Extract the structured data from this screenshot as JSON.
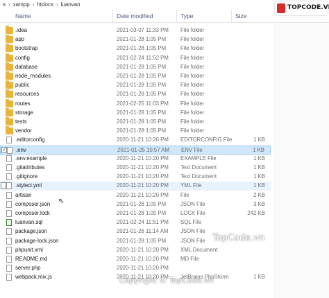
{
  "breadcrumb": [
    "s",
    "xampp",
    "htdocs",
    "luanvan"
  ],
  "columns": {
    "name": "Name",
    "date": "Date modified",
    "type": "Type",
    "size": "Size"
  },
  "logo_text": "TOPCODE.VN",
  "watermark_top": "TopCode.vn",
  "watermark_bottom": "Copyright © TopCode.vn",
  "files": [
    {
      "name": ".idea",
      "date": "2021-03-07 11:33 PM",
      "type": "File folder",
      "size": "",
      "icon": "folder-icon"
    },
    {
      "name": "app",
      "date": "2021-01-28 1:05 PM",
      "type": "File folder",
      "size": "",
      "icon": "folder-icon"
    },
    {
      "name": "bootstrap",
      "date": "2021-01-28 1:05 PM",
      "type": "File folder",
      "size": "",
      "icon": "folder-icon"
    },
    {
      "name": "config",
      "date": "2021-02-24 11:52 PM",
      "type": "File folder",
      "size": "",
      "icon": "folder-icon"
    },
    {
      "name": "database",
      "date": "2021-01-28 1:05 PM",
      "type": "File folder",
      "size": "",
      "icon": "folder-icon"
    },
    {
      "name": "node_modules",
      "date": "2021-01-28 1:05 PM",
      "type": "File folder",
      "size": "",
      "icon": "folder-icon"
    },
    {
      "name": "public",
      "date": "2021-01-28 1:05 PM",
      "type": "File folder",
      "size": "",
      "icon": "folder-icon"
    },
    {
      "name": "resources",
      "date": "2021-01-28 1:05 PM",
      "type": "File folder",
      "size": "",
      "icon": "folder-icon"
    },
    {
      "name": "routes",
      "date": "2021-02-25 11:03 PM",
      "type": "File folder",
      "size": "",
      "icon": "folder-icon"
    },
    {
      "name": "storage",
      "date": "2021-01-28 1:05 PM",
      "type": "File folder",
      "size": "",
      "icon": "folder-icon"
    },
    {
      "name": "tests",
      "date": "2021-01-28 1:05 PM",
      "type": "File folder",
      "size": "",
      "icon": "folder-icon"
    },
    {
      "name": "vendor",
      "date": "2021-01-28 1:05 PM",
      "type": "File folder",
      "size": "",
      "icon": "folder-icon"
    },
    {
      "name": ".editorconfig",
      "date": "2020-11-21 10:20 PM",
      "type": "EDITORCONFIG File",
      "size": "1 KB",
      "icon": "file-icon"
    },
    {
      "name": ".env",
      "date": "2021-01-25 10:57 AM",
      "type": "ENV File",
      "size": "1 KB",
      "icon": "file-icon",
      "selected": true
    },
    {
      "name": ".env.example",
      "date": "2020-11-21 10:20 PM",
      "type": "EXAMPLE File",
      "size": "1 KB",
      "icon": "file-icon"
    },
    {
      "name": ".gitattributes",
      "date": "2020-11-21 10:20 PM",
      "type": "Text Document",
      "size": "1 KB",
      "icon": "file-icon"
    },
    {
      "name": ".gitignore",
      "date": "2020-11-21 10:20 PM",
      "type": "Text Document",
      "size": "1 KB",
      "icon": "file-icon"
    },
    {
      "name": ".styleci.yml",
      "date": "2020-11-21 10:20 PM",
      "type": "YML File",
      "size": "1 KB",
      "icon": "file-icon",
      "hover": true
    },
    {
      "name": "artisan",
      "date": "2020-11-21 10:20 PM",
      "type": "File",
      "size": "2 KB",
      "icon": "file-icon"
    },
    {
      "name": "composer.json",
      "date": "2021-01-28 1:05 PM",
      "type": "JSON File",
      "size": "3 KB",
      "icon": "file-icon"
    },
    {
      "name": "composer.lock",
      "date": "2021-01-28 1:05 PM",
      "type": "LOCK File",
      "size": "242 KB",
      "icon": "file-icon"
    },
    {
      "name": "luanvan.sql",
      "date": "2021-02-24 11:51 PM",
      "type": "SQL File",
      "size": "",
      "icon": "sql-file-icon"
    },
    {
      "name": "package.json",
      "date": "2021-01-26 11:14 AM",
      "type": "JSON File",
      "size": "",
      "icon": "file-icon"
    },
    {
      "name": "package-lock.json",
      "date": "2021-01-28 1:05 PM",
      "type": "JSON File",
      "size": "",
      "icon": "file-icon"
    },
    {
      "name": "phpunit.xml",
      "date": "2020-11-21 10:20 PM",
      "type": "XML Document",
      "size": "",
      "icon": "file-icon"
    },
    {
      "name": "README.md",
      "date": "2020-11-21 10:20 PM",
      "type": "MD File",
      "size": "",
      "icon": "file-icon"
    },
    {
      "name": "server.php",
      "date": "2020-11-21 10:20 PM",
      "type": "",
      "size": "",
      "icon": "file-icon"
    },
    {
      "name": "webpack.mix.js",
      "date": "2020-11-21 10:20 PM",
      "type": "JetBrains PhpStorm",
      "size": "1 KB",
      "icon": "file-icon"
    }
  ]
}
